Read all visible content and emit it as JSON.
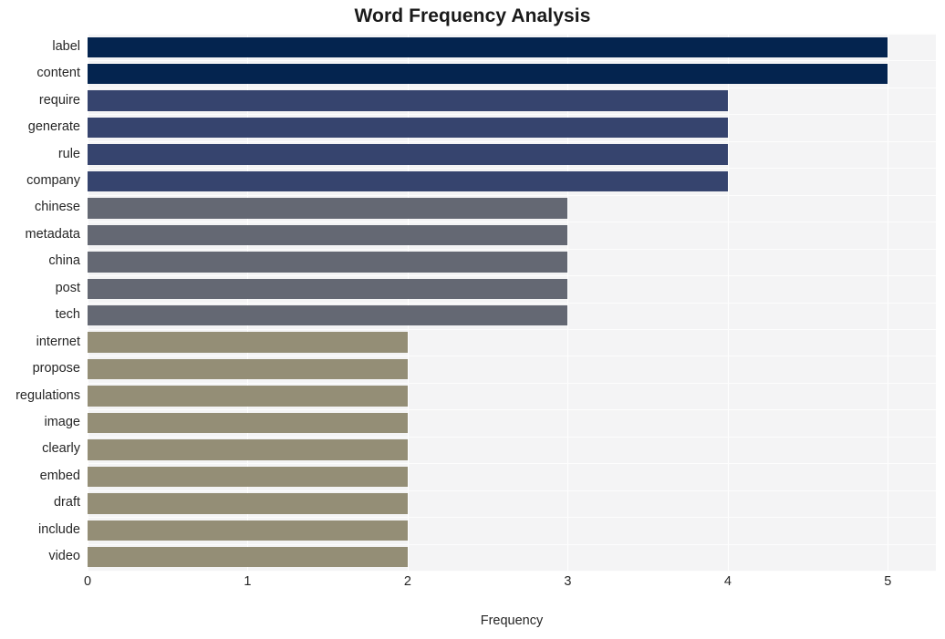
{
  "chart_data": {
    "type": "bar",
    "orientation": "horizontal",
    "title": "Word Frequency Analysis",
    "xlabel": "Frequency",
    "ylabel": "",
    "xlim": [
      0,
      5.3
    ],
    "xticks": [
      0,
      1,
      2,
      3,
      4,
      5
    ],
    "xtick_labels": [
      "0",
      "1",
      "2",
      "3",
      "4",
      "5"
    ],
    "grid": true,
    "legend": "none",
    "categories": [
      "label",
      "content",
      "require",
      "generate",
      "rule",
      "company",
      "chinese",
      "metadata",
      "china",
      "post",
      "tech",
      "internet",
      "propose",
      "regulations",
      "image",
      "clearly",
      "embed",
      "draft",
      "include",
      "video"
    ],
    "values": [
      5,
      5,
      4,
      4,
      4,
      4,
      3,
      3,
      3,
      3,
      3,
      2,
      2,
      2,
      2,
      2,
      2,
      2,
      2,
      2
    ],
    "bar_colors": [
      "#04244f",
      "#04244f",
      "#36446e",
      "#36446e",
      "#36446e",
      "#36446e",
      "#646873",
      "#646873",
      "#646873",
      "#646873",
      "#646873",
      "#948e76",
      "#948e76",
      "#948e76",
      "#948e76",
      "#948e76",
      "#948e76",
      "#948e76",
      "#948e76",
      "#948e76"
    ],
    "palette": {
      "value_5": "#04244f",
      "value_4": "#36446e",
      "value_3": "#646873",
      "value_2": "#948e76"
    },
    "plot_background": "#f4f4f5",
    "grid_color": "#ffffff",
    "figure_background": "#ffffff"
  }
}
